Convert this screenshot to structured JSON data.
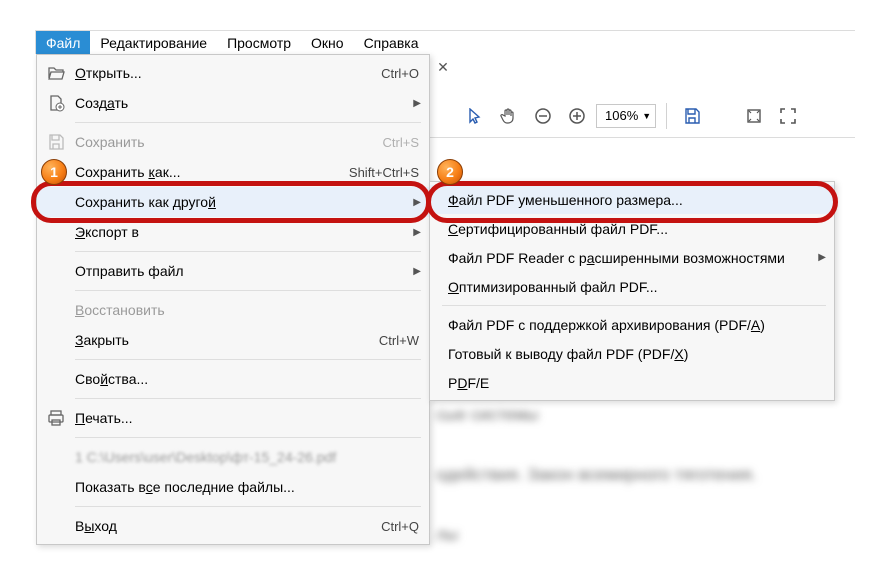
{
  "menubar": {
    "items": [
      {
        "label": "Файл",
        "active": true
      },
      {
        "label": "Редактирование",
        "active": false
      },
      {
        "label": "Просмотр",
        "active": false
      },
      {
        "label": "Окно",
        "active": false
      },
      {
        "label": "Справка",
        "active": false
      }
    ]
  },
  "file_menu": {
    "open": {
      "label": "Открыть...",
      "shortcut": "Ctrl+O"
    },
    "create": {
      "label": "Создать"
    },
    "save": {
      "label": "Сохранить",
      "shortcut": "Ctrl+S"
    },
    "save_as": {
      "label": "Сохранить как...",
      "shortcut": "Shift+Ctrl+S"
    },
    "save_as_other": {
      "label": "Сохранить как другой"
    },
    "export": {
      "label": "Экспорт в"
    },
    "send": {
      "label": "Отправить файл"
    },
    "revert": {
      "label": "Восстановить"
    },
    "close": {
      "label": "Закрыть",
      "shortcut": "Ctrl+W"
    },
    "properties": {
      "label": "Свойства..."
    },
    "print": {
      "label": "Печать..."
    },
    "recent_file": {
      "label": "1 C:\\Users\\user\\Desktop\\фт-15_24-26.pdf"
    },
    "show_recent": {
      "label": "Показать все последние файлы..."
    },
    "exit": {
      "label": "Выход",
      "shortcut": "Ctrl+Q"
    }
  },
  "save_as_other_submenu": {
    "reduced": {
      "label": "Файл PDF уменьшенного размера..."
    },
    "certified": {
      "label": "Сертифицированный файл PDF..."
    },
    "reader_ext": {
      "label": "Файл PDF Reader с расширенными возможностями"
    },
    "optimized": {
      "label": "Оптимизированный файл PDF..."
    },
    "archivable": {
      "label": "Файл PDF с поддержкой архивирования (PDF/A)"
    },
    "press_ready": {
      "label": "Готовый к выводу файл PDF (PDF/X)"
    },
    "pdfe": {
      "label": "PDF/E"
    }
  },
  "toolbar": {
    "zoom_value": "106%"
  },
  "annotations": {
    "badge1": "1",
    "badge2": "2"
  },
  "blurred_text": {
    "l1": "сые системы",
    "l2": "одействия. Закон всемирного тяготения.",
    "l3": "лы"
  }
}
